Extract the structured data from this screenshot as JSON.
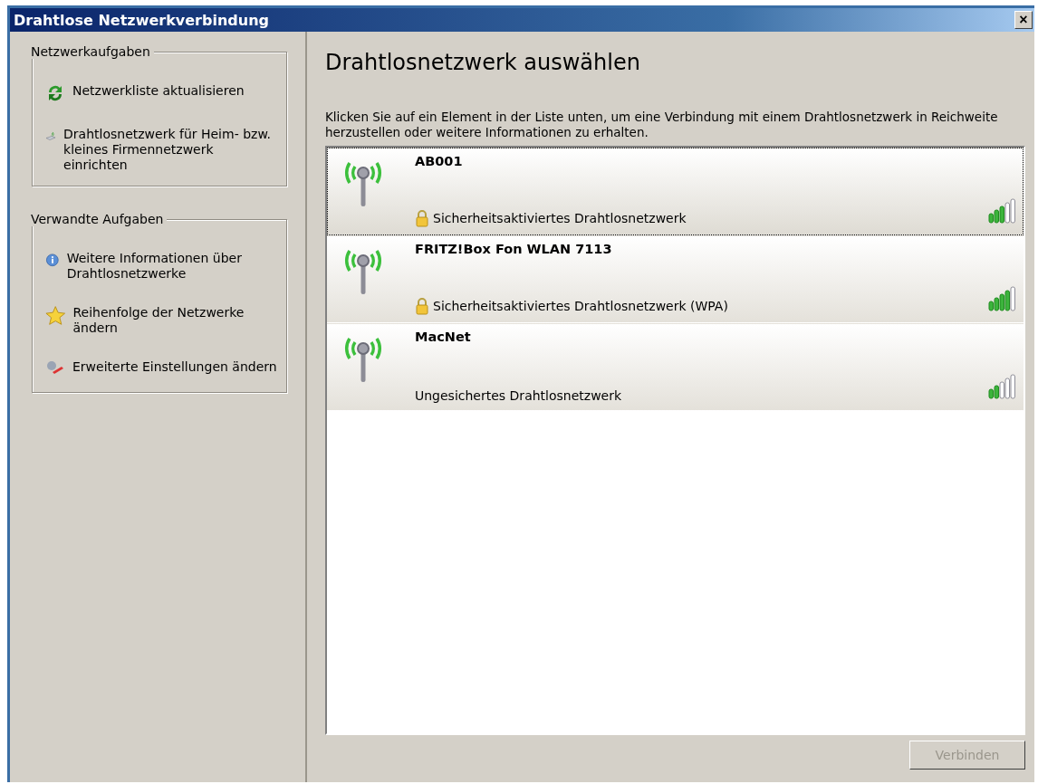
{
  "window": {
    "title": "Drahtlose Netzwerkverbindung",
    "close_label": "×"
  },
  "sidebar": {
    "groups": [
      {
        "title": "Netzwerkaufgaben",
        "items": [
          {
            "kind": "refresh",
            "label": "Netzwerkliste aktualisieren"
          },
          {
            "kind": "setup",
            "label": "Drahtlosnetzwerk für Heim- bzw. kleines Firmennetzwerk einrichten"
          }
        ]
      },
      {
        "title": "Verwandte Aufgaben",
        "items": [
          {
            "kind": "info",
            "label": "Weitere Informationen über Drahtlosnetzwerke"
          },
          {
            "kind": "star",
            "label": "Reihenfolge der Netzwerke ändern"
          },
          {
            "kind": "tools",
            "label": "Erweiterte Einstellungen ändern"
          }
        ]
      }
    ]
  },
  "main": {
    "heading": "Drahtlosnetzwerk auswählen",
    "description": "Klicken Sie auf ein Element in der Liste unten, um eine Verbindung mit einem Drahtlosnetzwerk in Reichweite herzustellen oder weitere Informationen zu erhalten.",
    "networks": [
      {
        "name": "AB001",
        "security": "Sicherheitsaktiviertes Drahtlosnetzwerk",
        "secured": true,
        "selected": true,
        "level": 0.6
      },
      {
        "name": "FRITZ!Box Fon WLAN 7113",
        "security": "Sicherheitsaktiviertes Drahtlosnetzwerk (WPA)",
        "secured": true,
        "selected": false,
        "level": 0.8
      },
      {
        "name": "MacNet",
        "security": "Ungesichertes Drahtlosnetzwerk",
        "secured": false,
        "selected": false,
        "level": 0.4
      }
    ],
    "connect_button": {
      "label": "Verbinden",
      "disabled": true
    }
  }
}
